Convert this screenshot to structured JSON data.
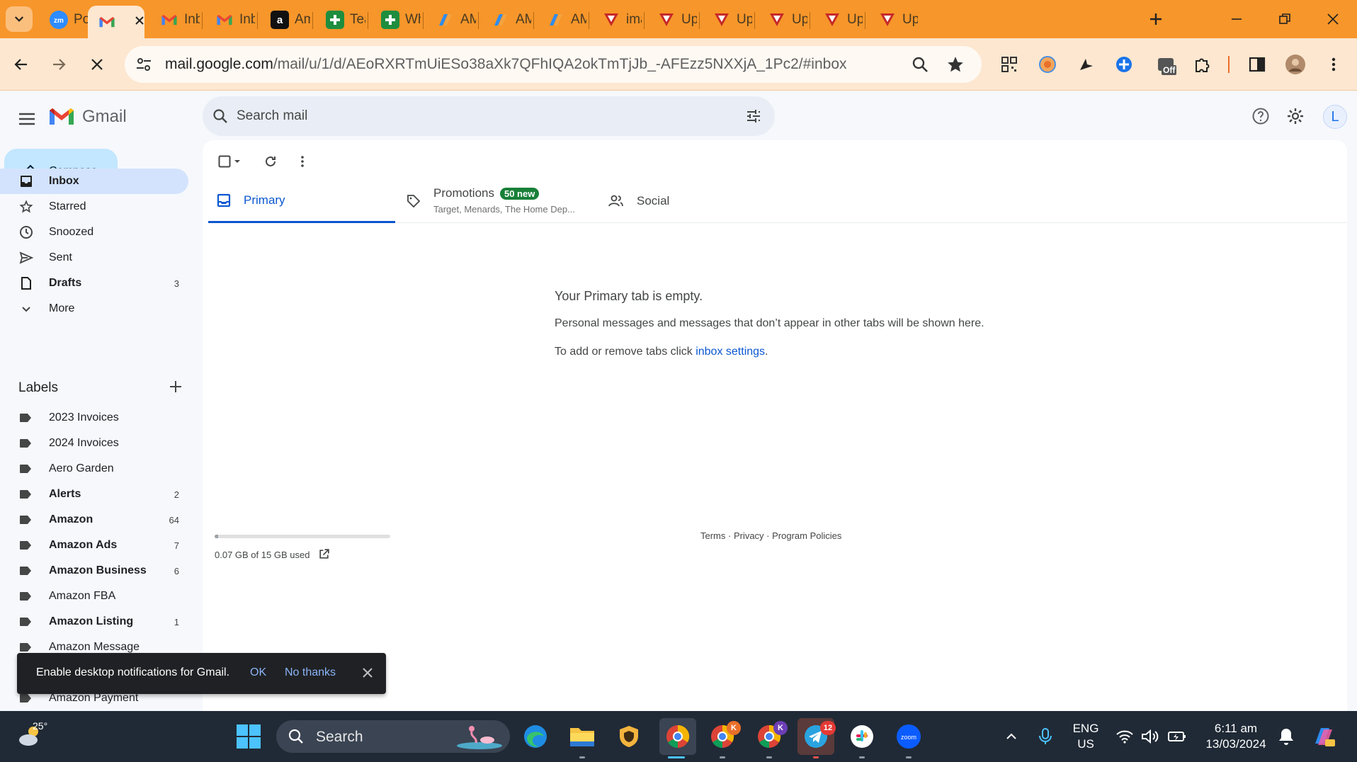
{
  "browser": {
    "tabs": [
      {
        "title": "Pos",
        "favicon": "zoom"
      },
      {
        "title": "",
        "favicon": "gmail",
        "active": true
      },
      {
        "title": "Inb",
        "favicon": "gmail"
      },
      {
        "title": "Inb",
        "favicon": "gmail"
      },
      {
        "title": "Am",
        "favicon": "amazon"
      },
      {
        "title": "Tea",
        "favicon": "sheets"
      },
      {
        "title": "Wh",
        "favicon": "sheets"
      },
      {
        "title": "AM",
        "favicon": "copilot"
      },
      {
        "title": "AM",
        "favicon": "copilot"
      },
      {
        "title": "AM",
        "favicon": "copilot"
      },
      {
        "title": "ima",
        "favicon": "app"
      },
      {
        "title": "Upl",
        "favicon": "app"
      },
      {
        "title": "Up",
        "favicon": "app"
      },
      {
        "title": "Up",
        "favicon": "app"
      },
      {
        "title": "Up",
        "favicon": "app"
      },
      {
        "title": "Up",
        "favicon": "app"
      }
    ],
    "url_host": "mail.google.com",
    "url_path": "/mail/u/1/d/AEoRXRTmUiESo38aXk7QFhIQA2okTmTjJb_-AFEzz5NXXjA_1Pc2/#inbox",
    "ext_badge": "Off",
    "colors": {
      "tabbar": "#f7962a",
      "toolbar": "#fde7d0"
    }
  },
  "gmail": {
    "logo_text": "Gmail",
    "search_placeholder": "Search mail",
    "compose_label": "Compose",
    "nav": [
      {
        "label": "Inbox",
        "icon": "inbox-icon",
        "active": true,
        "bold": true,
        "count": ""
      },
      {
        "label": "Starred",
        "icon": "star-icon",
        "count": ""
      },
      {
        "label": "Snoozed",
        "icon": "clock-icon",
        "count": ""
      },
      {
        "label": "Sent",
        "icon": "send-icon",
        "count": ""
      },
      {
        "label": "Drafts",
        "icon": "draft-icon",
        "bold": true,
        "count": "3"
      },
      {
        "label": "More",
        "icon": "chevron-down-icon",
        "count": ""
      }
    ],
    "labels_title": "Labels",
    "labels": [
      {
        "label": "2023 Invoices",
        "bold": false,
        "count": ""
      },
      {
        "label": "2024 Invoices",
        "bold": false,
        "count": ""
      },
      {
        "label": "Aero Garden",
        "bold": false,
        "count": ""
      },
      {
        "label": "Alerts",
        "bold": true,
        "count": "2"
      },
      {
        "label": "Amazon",
        "bold": true,
        "count": "64"
      },
      {
        "label": "Amazon Ads",
        "bold": true,
        "count": "7"
      },
      {
        "label": "Amazon Business",
        "bold": true,
        "count": "6"
      },
      {
        "label": "Amazon FBA",
        "bold": false,
        "count": ""
      },
      {
        "label": "Amazon Listing",
        "bold": true,
        "count": "1"
      },
      {
        "label": "Amazon Message",
        "bold": false,
        "count": ""
      },
      {
        "label": "",
        "bold": false,
        "count": ""
      },
      {
        "label": "Amazon Payment",
        "bold": false,
        "count": ""
      }
    ],
    "inbox_tabs": [
      {
        "label": "Primary",
        "selected": true
      },
      {
        "label": "Promotions",
        "badge": "50 new",
        "subtitle": "Target, Menards, The Home Dep..."
      },
      {
        "label": "Social"
      }
    ],
    "empty_title": "Your Primary tab is empty.",
    "empty_line1": "Personal messages and messages that don’t appear in other tabs will be shown here.",
    "empty_line2_prefix": "To add or remove tabs click ",
    "empty_line2_link": "inbox settings",
    "empty_line2_suffix": ".",
    "storage_text": "0.07 GB of 15 GB used",
    "storage_fraction": 0.005,
    "footer_links": "Terms · Privacy · Program Policies",
    "account_initial": "L",
    "colors": {
      "compose": "#c2e7ff",
      "active_nav": "#d3e3fd",
      "accent": "#0b57d0",
      "badge": "#188038"
    }
  },
  "toast": {
    "message": "Enable desktop notifications for Gmail.",
    "ok": "OK",
    "no_thanks": "No thanks"
  },
  "taskbar": {
    "weather_temp": "25°",
    "search_label": "Search",
    "telegram_badge": "12",
    "chrome_profile_k": "K",
    "lang_line1": "ENG",
    "lang_line2": "US",
    "time": "6:11 am",
    "date": "13/03/2024"
  }
}
